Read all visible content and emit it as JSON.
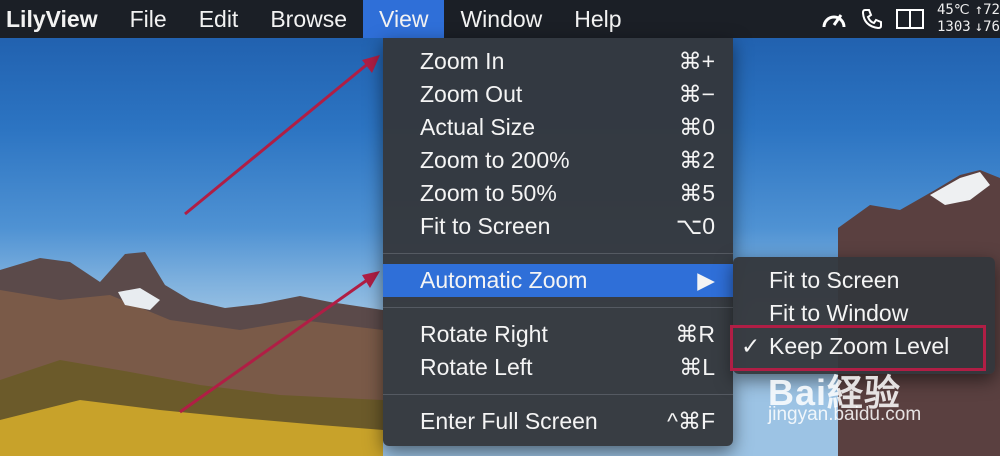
{
  "menubar": {
    "app_name": "LilyView",
    "items": [
      "File",
      "Edit",
      "Browse",
      "View",
      "Window",
      "Help"
    ],
    "active_item": "View",
    "status": {
      "icons": [
        "speedometer-icon",
        "phone-icon",
        "split-view-icon"
      ],
      "temperature": "45℃",
      "fan": "1303",
      "upload": "↑72",
      "download": "↓76"
    }
  },
  "view_menu": {
    "items": [
      {
        "label": "Zoom In",
        "shortcut": "⌘+"
      },
      {
        "label": "Zoom Out",
        "shortcut": "⌘−"
      },
      {
        "label": "Actual Size",
        "shortcut": "⌘0"
      },
      {
        "label": "Zoom to 200%",
        "shortcut": "⌘2"
      },
      {
        "label": "Zoom to 50%",
        "shortcut": "⌘5"
      },
      {
        "label": "Fit to Screen",
        "shortcut": "⌥0"
      },
      {
        "label": "Automatic Zoom",
        "shortcut": "▶"
      },
      {
        "label": "Rotate Right",
        "shortcut": "⌘R"
      },
      {
        "label": "Rotate Left",
        "shortcut": "⌘L"
      },
      {
        "label": "Enter Full Screen",
        "shortcut": "^⌘F"
      }
    ],
    "highlighted": "Automatic Zoom"
  },
  "submenu": {
    "items": [
      {
        "label": "Fit to Screen",
        "checked": false
      },
      {
        "label": "Fit to Window",
        "checked": false
      },
      {
        "label": "Keep Zoom Level",
        "checked": true
      }
    ],
    "check_mark": "✓"
  },
  "watermark": {
    "logo": "Bai経验",
    "url": "jingyan.baidu.com"
  },
  "colors": {
    "menubar": "#1b1f26",
    "highlight": "#2f6fd8",
    "menu_bg": "#34373c",
    "annotation": "#b01e45"
  }
}
